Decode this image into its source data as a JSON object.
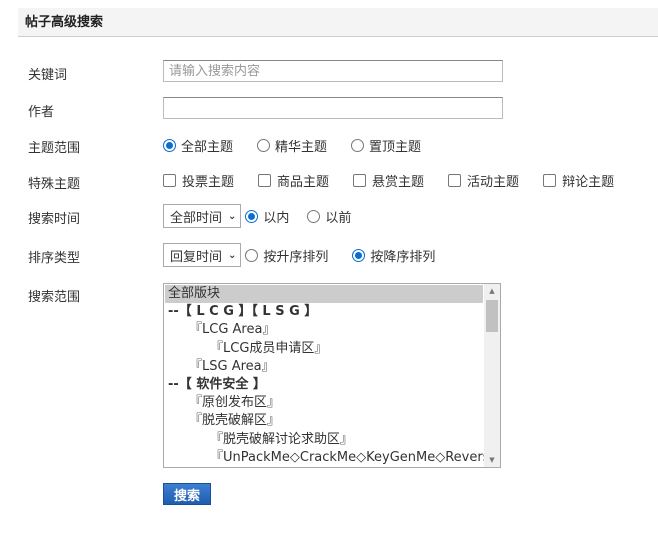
{
  "header": {
    "title": "帖子高级搜索"
  },
  "keyword": {
    "label": "关键词",
    "placeholder": "请输入搜索内容",
    "value": ""
  },
  "author": {
    "label": "作者",
    "value": ""
  },
  "topic_range": {
    "label": "主题范围",
    "options": [
      {
        "label": "全部主题",
        "checked": true
      },
      {
        "label": "精华主题",
        "checked": false
      },
      {
        "label": "置顶主题",
        "checked": false
      }
    ]
  },
  "special": {
    "label": "特殊主题",
    "options": [
      {
        "label": "投票主题",
        "checked": false
      },
      {
        "label": "商品主题",
        "checked": false
      },
      {
        "label": "悬赏主题",
        "checked": false
      },
      {
        "label": "活动主题",
        "checked": false
      },
      {
        "label": "辩论主题",
        "checked": false
      }
    ]
  },
  "search_time": {
    "label": "搜索时间",
    "select": "全部时间",
    "options": [
      {
        "label": "以内",
        "checked": true
      },
      {
        "label": "以前",
        "checked": false
      }
    ]
  },
  "sort": {
    "label": "排序类型",
    "select": "回复时间",
    "options": [
      {
        "label": "按升序排列",
        "checked": false
      },
      {
        "label": "按降序排列",
        "checked": true
      }
    ]
  },
  "scope": {
    "label": "搜索范围",
    "items": [
      {
        "text": "全部版块",
        "selected": true,
        "bold": false,
        "indent": 0
      },
      {
        "text": "--【 L C G 】【 L S G 】",
        "selected": false,
        "bold": true,
        "indent": 0
      },
      {
        "text": "『LCG Area』",
        "selected": false,
        "bold": false,
        "indent": 1
      },
      {
        "text": "『LCG成员申请区』",
        "selected": false,
        "bold": false,
        "indent": 2
      },
      {
        "text": "『LSG Area』",
        "selected": false,
        "bold": false,
        "indent": 1
      },
      {
        "text": "--【 软件安全 】",
        "selected": false,
        "bold": true,
        "indent": 0
      },
      {
        "text": "『原创发布区』",
        "selected": false,
        "bold": false,
        "indent": 1
      },
      {
        "text": "『脱壳破解区』",
        "selected": false,
        "bold": false,
        "indent": 1
      },
      {
        "text": "『脱壳破解讨论求助区』",
        "selected": false,
        "bold": false,
        "indent": 2
      },
      {
        "text": "『UnPackMe◇CrackMe◇KeyGenMe◇ReverseMe』",
        "selected": false,
        "bold": false,
        "indent": 2
      }
    ]
  },
  "submit": {
    "label": "搜索"
  },
  "colors": {
    "accent": "#0a6ed1",
    "button": "#2a6bc0"
  }
}
